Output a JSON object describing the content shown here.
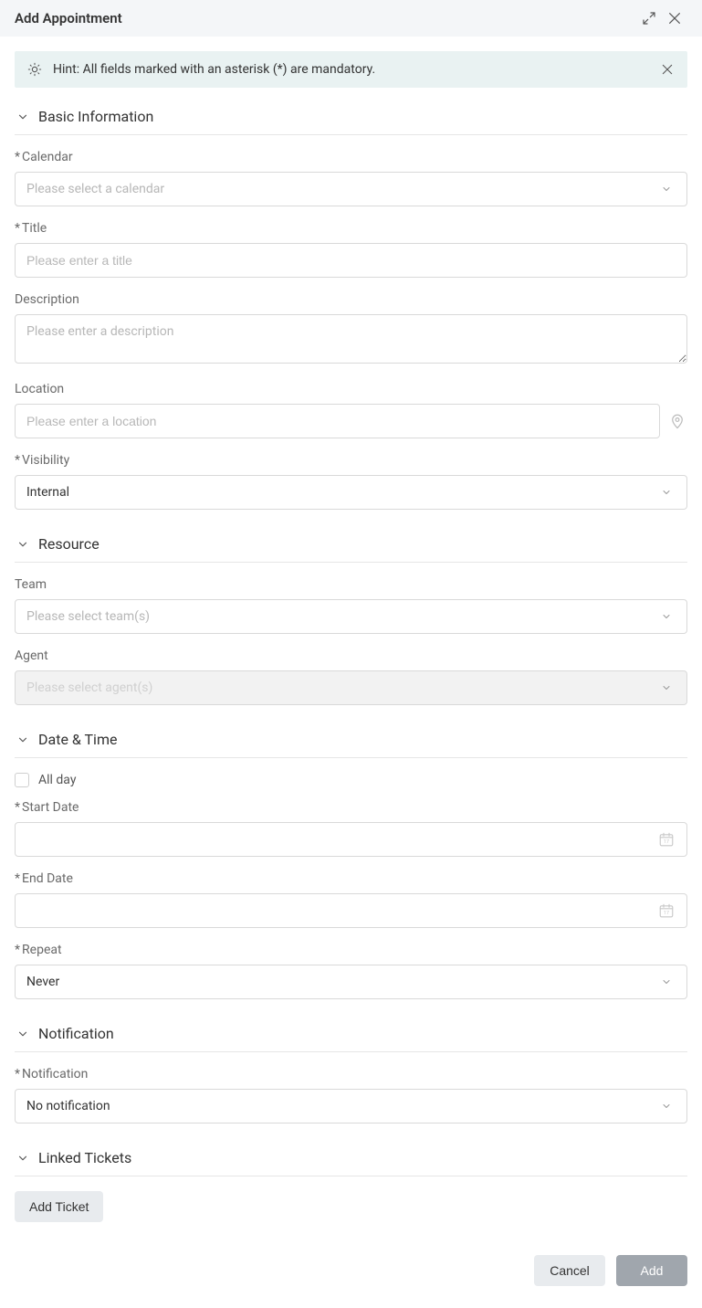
{
  "dialog": {
    "title": "Add Appointment"
  },
  "hint": {
    "text": "Hint: All fields marked with an asterisk (*) are mandatory."
  },
  "sections": {
    "basic": {
      "title": "Basic Information",
      "calendar_label": "Calendar",
      "calendar_placeholder": "Please select a calendar",
      "title_label": "Title",
      "title_placeholder": "Please enter a title",
      "description_label": "Description",
      "description_placeholder": "Please enter a description",
      "location_label": "Location",
      "location_placeholder": "Please enter a location",
      "visibility_label": "Visibility",
      "visibility_value": "Internal"
    },
    "resource": {
      "title": "Resource",
      "team_label": "Team",
      "team_placeholder": "Please select team(s)",
      "agent_label": "Agent",
      "agent_placeholder": "Please select agent(s)"
    },
    "datetime": {
      "title": "Date & Time",
      "allday_label": "All day",
      "start_label": "Start Date",
      "end_label": "End Date",
      "repeat_label": "Repeat",
      "repeat_value": "Never"
    },
    "notification": {
      "title": "Notification",
      "label": "Notification",
      "value": "No notification"
    },
    "linked": {
      "title": "Linked Tickets",
      "add_ticket_label": "Add Ticket"
    }
  },
  "footer": {
    "cancel": "Cancel",
    "add": "Add"
  }
}
